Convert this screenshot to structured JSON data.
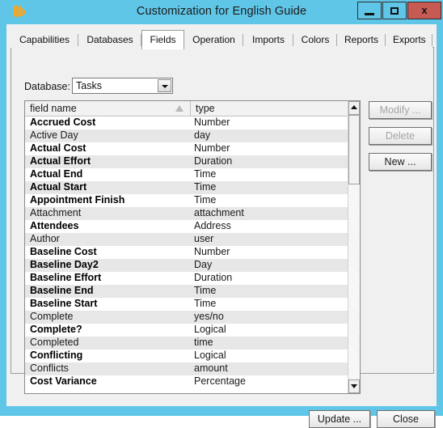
{
  "window": {
    "title": "Customization for English Guide",
    "icon": "app-icon",
    "controls": {
      "minimize": "─",
      "maximize": "□",
      "close": "x"
    },
    "titlebar_color": "#60c6e8",
    "close_button_color": "#c75b54",
    "body_color": "#f0f0f0"
  },
  "tabs": [
    {
      "label": "Capabilities",
      "active": false
    },
    {
      "label": "Databases",
      "active": false
    },
    {
      "label": "Fields",
      "active": true
    },
    {
      "label": "Operation",
      "active": false
    },
    {
      "label": "Imports",
      "active": false
    },
    {
      "label": "Colors",
      "active": false
    },
    {
      "label": "Reports",
      "active": false
    },
    {
      "label": "Exports",
      "active": false
    }
  ],
  "database": {
    "label": "Database:",
    "value": "Tasks",
    "options": [
      "Tasks"
    ]
  },
  "list": {
    "columns": [
      {
        "key": "field_name",
        "label": "field name",
        "sort": "ascending"
      },
      {
        "key": "type",
        "label": "type",
        "sort": "none"
      }
    ],
    "rows": [
      {
        "field_name": "Accrued Cost",
        "type": "Number",
        "bold": true
      },
      {
        "field_name": "Active Day",
        "type": "day",
        "bold": false
      },
      {
        "field_name": "Actual Cost",
        "type": "Number",
        "bold": true
      },
      {
        "field_name": "Actual Effort",
        "type": "Duration",
        "bold": true
      },
      {
        "field_name": "Actual End",
        "type": "Time",
        "bold": true
      },
      {
        "field_name": "Actual Start",
        "type": "Time",
        "bold": true
      },
      {
        "field_name": "Appointment Finish",
        "type": "Time",
        "bold": true
      },
      {
        "field_name": "Attachment",
        "type": "attachment",
        "bold": false
      },
      {
        "field_name": "Attendees",
        "type": "Address",
        "bold": true
      },
      {
        "field_name": "Author",
        "type": "user",
        "bold": false
      },
      {
        "field_name": "Baseline Cost",
        "type": "Number",
        "bold": true
      },
      {
        "field_name": "Baseline Day2",
        "type": "Day",
        "bold": true
      },
      {
        "field_name": "Baseline Effort",
        "type": "Duration",
        "bold": true
      },
      {
        "field_name": "Baseline End",
        "type": "Time",
        "bold": true
      },
      {
        "field_name": "Baseline Start",
        "type": "Time",
        "bold": true
      },
      {
        "field_name": "Complete",
        "type": "yes/no",
        "bold": false
      },
      {
        "field_name": "Complete?",
        "type": "Logical",
        "bold": true
      },
      {
        "field_name": "Completed",
        "type": "time",
        "bold": false
      },
      {
        "field_name": "Conflicting",
        "type": "Logical",
        "bold": true
      },
      {
        "field_name": "Conflicts",
        "type": "amount",
        "bold": false
      },
      {
        "field_name": "Cost Variance",
        "type": "Percentage",
        "bold": true
      }
    ]
  },
  "scrollbar": {
    "up_arrow": "▲",
    "down_arrow": "▼",
    "thumb_position": "top"
  },
  "side_buttons": [
    {
      "label": "Modify ...",
      "enabled": false
    },
    {
      "label": "Delete",
      "enabled": false
    },
    {
      "label": "New ...",
      "enabled": true
    }
  ],
  "footer_buttons": [
    {
      "label": "Update ...",
      "enabled": true
    },
    {
      "label": "Close",
      "enabled": true
    }
  ]
}
